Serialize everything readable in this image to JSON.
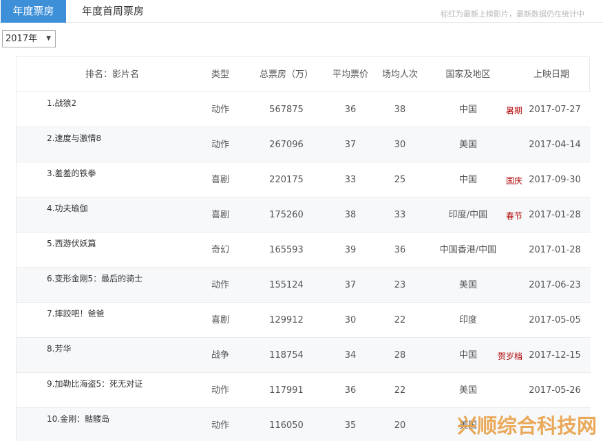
{
  "tabs": [
    {
      "label": "年度票房",
      "active": true
    },
    {
      "label": "年度首周票房",
      "active": false
    }
  ],
  "notice": "标红为最新上榜影片，最新数据仍在统计中",
  "year_select": {
    "value": "2017年"
  },
  "table": {
    "headers": {
      "rank_name": "排名：影片名",
      "type": "类型",
      "box": "总票房（万）",
      "price": "平均票价",
      "people": "场均人次",
      "country": "国家及地区",
      "date": "上映日期"
    },
    "rows": [
      {
        "name": "1.战狼2",
        "type": "动作",
        "box": "567875",
        "price": "36",
        "people": "38",
        "country": "中国",
        "tag": "暑期",
        "date": "2017-07-27"
      },
      {
        "name": "2.速度与激情8",
        "type": "动作",
        "box": "267096",
        "price": "37",
        "people": "30",
        "country": "美国",
        "tag": "",
        "date": "2017-04-14"
      },
      {
        "name": "3.羞羞的铁拳",
        "type": "喜剧",
        "box": "220175",
        "price": "33",
        "people": "25",
        "country": "中国",
        "tag": "国庆",
        "date": "2017-09-30"
      },
      {
        "name": "4.功夫瑜伽",
        "type": "喜剧",
        "box": "175260",
        "price": "38",
        "people": "33",
        "country": "印度/中国",
        "tag": "春节",
        "date": "2017-01-28"
      },
      {
        "name": "5.西游伏妖篇",
        "type": "奇幻",
        "box": "165593",
        "price": "39",
        "people": "36",
        "country": "中国香港/中国",
        "tag": "",
        "date": "2017-01-28"
      },
      {
        "name": "6.变形金刚5：最后的骑士",
        "type": "动作",
        "box": "155124",
        "price": "37",
        "people": "23",
        "country": "美国",
        "tag": "",
        "date": "2017-06-23"
      },
      {
        "name": "7.摔跤吧！爸爸",
        "type": "喜剧",
        "box": "129912",
        "price": "30",
        "people": "22",
        "country": "印度",
        "tag": "",
        "date": "2017-05-05"
      },
      {
        "name": "8.芳华",
        "type": "战争",
        "box": "118754",
        "price": "34",
        "people": "28",
        "country": "中国",
        "tag": "贺岁档",
        "date": "2017-12-15"
      },
      {
        "name": "9.加勒比海盗5：死无对证",
        "type": "动作",
        "box": "117991",
        "price": "36",
        "people": "22",
        "country": "美国",
        "tag": "",
        "date": "2017-05-26"
      },
      {
        "name": "10.金刚：骷髅岛",
        "type": "动作",
        "box": "116050",
        "price": "35",
        "people": "20",
        "country": "美国",
        "tag": "",
        "date": ""
      }
    ]
  },
  "watermark": "兴顺综合科技网"
}
